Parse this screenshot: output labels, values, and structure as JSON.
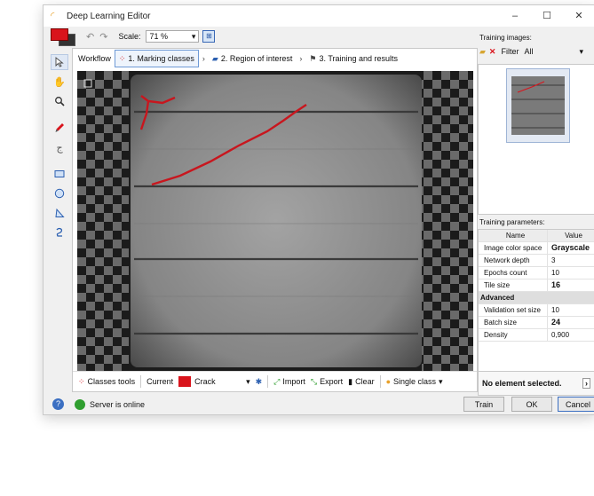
{
  "window": {
    "title": "Deep Learning Editor",
    "minimize": "–",
    "maximize": "☐",
    "close": "✕"
  },
  "toolbar": {
    "scale_label": "Scale:",
    "scale_value": "71 %",
    "undo": "↶",
    "redo": "↷",
    "primary_color": "#d9141c"
  },
  "workflow": {
    "title": "Workflow",
    "steps": [
      {
        "icon": "classes-icon",
        "label": "1. Marking classes"
      },
      {
        "icon": "roi-icon",
        "label": "2. Region of interest"
      },
      {
        "icon": "flag-icon",
        "label": "3. Training and results"
      }
    ]
  },
  "bottom": {
    "classes_tools": "Classes tools",
    "current": "Current",
    "class_name": "Crack",
    "class_color": "#d9141c",
    "import": "Import",
    "export": "Export",
    "clear": "Clear",
    "single_class": "Single class"
  },
  "right": {
    "training_images_label": "Training images:",
    "filter_label": "Filter",
    "filter_value": "All",
    "training_params_label": "Training parameters:",
    "params_header": {
      "name": "Name",
      "value": "Value"
    },
    "params": [
      {
        "name": "Image color space",
        "value": "Grayscale",
        "bold": true
      },
      {
        "name": "Network depth",
        "value": "3",
        "bold": false
      },
      {
        "name": "Epochs count",
        "value": "10",
        "bold": false
      },
      {
        "name": "Tile size",
        "value": "16",
        "bold": true
      }
    ],
    "advanced_label": "Advanced",
    "advanced_params": [
      {
        "name": "Validation set size",
        "value": "10",
        "bold": false
      },
      {
        "name": "Batch size",
        "value": "24",
        "bold": true
      },
      {
        "name": "Density",
        "value": "0,900",
        "bold": false
      }
    ],
    "no_element": "No element selected."
  },
  "status": {
    "server": "Server is online",
    "server_color": "#2f9e2f"
  },
  "buttons": {
    "train": "Train",
    "ok": "OK",
    "cancel": "Cancel"
  }
}
